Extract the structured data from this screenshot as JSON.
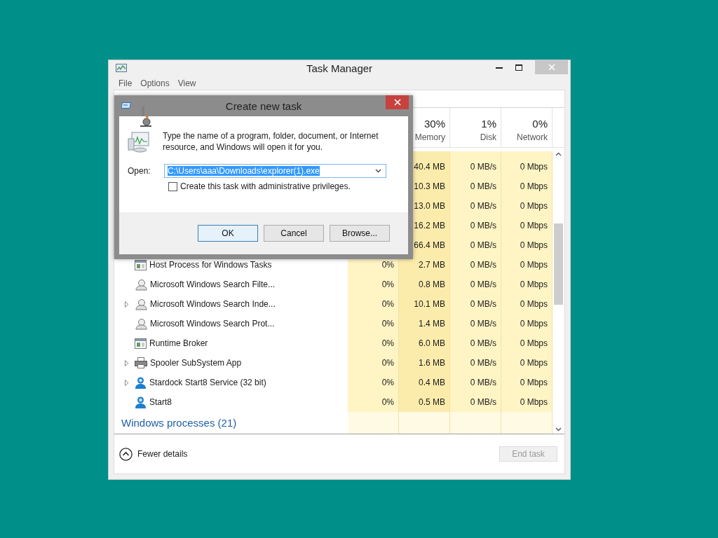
{
  "task_manager": {
    "title": "Task Manager",
    "menu": [
      "File",
      "Options",
      "View"
    ],
    "columns": [
      {
        "percent": "30%",
        "label": "Memory"
      },
      {
        "percent": "1%",
        "label": "Disk"
      },
      {
        "percent": "0%",
        "label": "Network"
      }
    ],
    "rows": [
      {
        "memory": "40.4 MB",
        "disk": "0 MB/s",
        "network": "0 Mbps"
      },
      {
        "memory": "10.3 MB",
        "disk": "0 MB/s",
        "network": "0 Mbps"
      },
      {
        "memory": "13.0 MB",
        "disk": "0 MB/s",
        "network": "0 Mbps"
      },
      {
        "memory": "16.2 MB",
        "disk": "0 MB/s",
        "network": "0 Mbps"
      },
      {
        "memory": "66.4 MB",
        "disk": "0 MB/s",
        "network": "0 Mbps"
      },
      {
        "name": "Host Process for Windows Tasks",
        "kind": "window",
        "expandable": false,
        "cpu": "0%",
        "memory": "2.7 MB",
        "disk": "0 MB/s",
        "network": "0 Mbps"
      },
      {
        "name": "Microsoft Windows Search Filte...",
        "kind": "search",
        "expandable": false,
        "cpu": "0%",
        "memory": "0.8 MB",
        "disk": "0 MB/s",
        "network": "0 Mbps"
      },
      {
        "name": "Microsoft Windows Search Inde...",
        "kind": "search",
        "expandable": true,
        "cpu": "0%",
        "memory": "10.1 MB",
        "disk": "0 MB/s",
        "network": "0 Mbps"
      },
      {
        "name": "Microsoft Windows Search Prot...",
        "kind": "search",
        "expandable": false,
        "cpu": "0%",
        "memory": "1.4 MB",
        "disk": "0 MB/s",
        "network": "0 Mbps"
      },
      {
        "name": "Runtime Broker",
        "kind": "window",
        "expandable": false,
        "cpu": "0%",
        "memory": "6.0 MB",
        "disk": "0 MB/s",
        "network": "0 Mbps"
      },
      {
        "name": "Spooler SubSystem App",
        "kind": "printer",
        "expandable": true,
        "cpu": "0%",
        "memory": "1.6 MB",
        "disk": "0 MB/s",
        "network": "0 Mbps"
      },
      {
        "name": "Stardock Start8 Service (32 bit)",
        "kind": "person",
        "expandable": true,
        "cpu": "0%",
        "memory": "0.4 MB",
        "disk": "0 MB/s",
        "network": "0 Mbps"
      },
      {
        "name": "Start8",
        "kind": "person",
        "expandable": false,
        "cpu": "0%",
        "memory": "0.5 MB",
        "disk": "0 MB/s",
        "network": "0 Mbps"
      }
    ],
    "group": "Windows processes (21)",
    "fewer_details": "Fewer details",
    "end_task": {
      "label": "End task",
      "disabled": true
    }
  },
  "dialog": {
    "title": "Create new task",
    "message": "Type the name of a program, folder, document, or Internet resource, and Windows will open it for you.",
    "open_label": "Open:",
    "open_value": "C:\\Users\\aaa\\Downloads\\explorer(1).exe",
    "admin_checkbox": {
      "label": "Create this task with administrative privileges.",
      "checked": false
    },
    "buttons": [
      {
        "label": "OK",
        "default": true
      },
      {
        "label": "Cancel",
        "default": false
      },
      {
        "label": "Browse...",
        "default": false
      }
    ]
  }
}
